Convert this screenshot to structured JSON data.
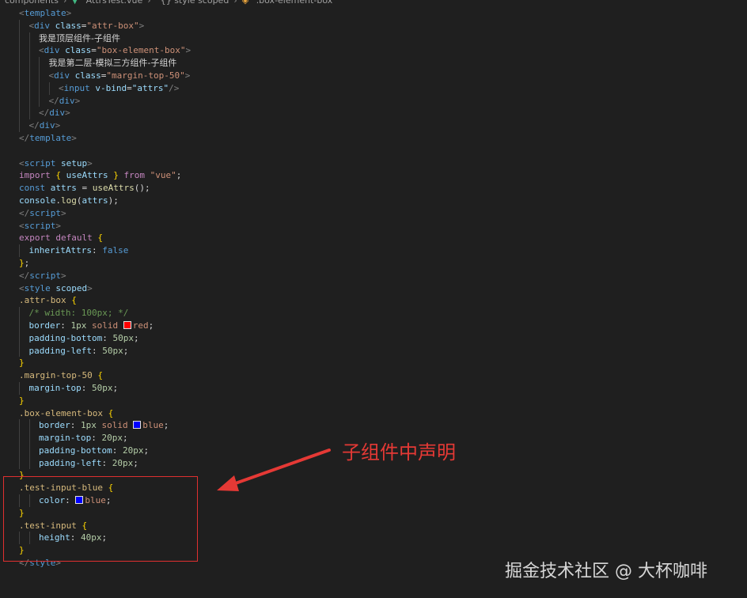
{
  "breadcrumb": [
    "components",
    "AttrsTest.vue",
    "{} style scoped",
    ".box-element-box"
  ],
  "code_lines": [
    {
      "indent": 0,
      "tokens": [
        [
          "ang",
          "<"
        ],
        [
          "tag",
          "template"
        ],
        [
          "ang",
          ">"
        ]
      ]
    },
    {
      "indent": 1,
      "tokens": [
        [
          "ang",
          "<"
        ],
        [
          "tag",
          "div"
        ],
        [
          "punc",
          " "
        ],
        [
          "attr",
          "class"
        ],
        [
          "punc",
          "="
        ],
        [
          "str",
          "\"attr-box\""
        ],
        [
          "ang",
          ">"
        ]
      ]
    },
    {
      "indent": 2,
      "tokens": [
        [
          "txt",
          "我是顶层组件-子组件"
        ]
      ]
    },
    {
      "indent": 2,
      "tokens": [
        [
          "ang",
          "<"
        ],
        [
          "tag",
          "div"
        ],
        [
          "punc",
          " "
        ],
        [
          "attr",
          "class"
        ],
        [
          "punc",
          "="
        ],
        [
          "str",
          "\"box-element-box\""
        ],
        [
          "ang",
          ">"
        ]
      ]
    },
    {
      "indent": 3,
      "tokens": [
        [
          "txt",
          "我是第二层-模拟三方组件-子组件"
        ]
      ]
    },
    {
      "indent": 3,
      "tokens": [
        [
          "ang",
          "<"
        ],
        [
          "tag",
          "div"
        ],
        [
          "punc",
          " "
        ],
        [
          "attr",
          "class"
        ],
        [
          "punc",
          "="
        ],
        [
          "str",
          "\"margin-top-50\""
        ],
        [
          "ang",
          ">"
        ]
      ]
    },
    {
      "indent": 4,
      "tokens": [
        [
          "ang",
          "<"
        ],
        [
          "tag",
          "input"
        ],
        [
          "punc",
          " "
        ],
        [
          "attr",
          "v-bind"
        ],
        [
          "punc",
          "="
        ],
        [
          "var",
          "\"attrs\""
        ],
        [
          "ang",
          "/>"
        ]
      ]
    },
    {
      "indent": 3,
      "tokens": [
        [
          "ang",
          "</"
        ],
        [
          "tag",
          "div"
        ],
        [
          "ang",
          ">"
        ]
      ]
    },
    {
      "indent": 2,
      "tokens": [
        [
          "ang",
          "</"
        ],
        [
          "tag",
          "div"
        ],
        [
          "ang",
          ">"
        ]
      ]
    },
    {
      "indent": 1,
      "tokens": [
        [
          "ang",
          "</"
        ],
        [
          "tag",
          "div"
        ],
        [
          "ang",
          ">"
        ]
      ]
    },
    {
      "indent": 0,
      "tokens": [
        [
          "ang",
          "</"
        ],
        [
          "tag",
          "template"
        ],
        [
          "ang",
          ">"
        ]
      ]
    },
    {
      "indent": 0,
      "tokens": []
    },
    {
      "indent": 0,
      "tokens": [
        [
          "ang",
          "<"
        ],
        [
          "tag",
          "script"
        ],
        [
          "punc",
          " "
        ],
        [
          "attr",
          "setup"
        ],
        [
          "ang",
          ">"
        ]
      ]
    },
    {
      "indent": 0,
      "tokens": [
        [
          "kw",
          "import"
        ],
        [
          "punc",
          " "
        ],
        [
          "brace",
          "{"
        ],
        [
          "punc",
          " "
        ],
        [
          "var",
          "useAttrs"
        ],
        [
          "punc",
          " "
        ],
        [
          "brace",
          "}"
        ],
        [
          "punc",
          " "
        ],
        [
          "kw",
          "from"
        ],
        [
          "punc",
          " "
        ],
        [
          "str",
          "\"vue\""
        ],
        [
          "punc",
          ";"
        ]
      ]
    },
    {
      "indent": 0,
      "tokens": [
        [
          "tag",
          "const"
        ],
        [
          "punc",
          " "
        ],
        [
          "var",
          "attrs"
        ],
        [
          "punc",
          " = "
        ],
        [
          "fn",
          "useAttrs"
        ],
        [
          "punc",
          "();"
        ]
      ]
    },
    {
      "indent": 0,
      "tokens": [
        [
          "var",
          "console"
        ],
        [
          "punc",
          "."
        ],
        [
          "fn",
          "log"
        ],
        [
          "punc",
          "("
        ],
        [
          "var",
          "attrs"
        ],
        [
          "punc",
          ");"
        ]
      ]
    },
    {
      "indent": 0,
      "tokens": [
        [
          "ang",
          "</"
        ],
        [
          "tag",
          "script"
        ],
        [
          "ang",
          ">"
        ]
      ]
    },
    {
      "indent": 0,
      "tokens": [
        [
          "ang",
          "<"
        ],
        [
          "tag",
          "script"
        ],
        [
          "ang",
          ">"
        ]
      ]
    },
    {
      "indent": 0,
      "tokens": [
        [
          "kw",
          "export"
        ],
        [
          "punc",
          " "
        ],
        [
          "kw",
          "default"
        ],
        [
          "punc",
          " "
        ],
        [
          "brace",
          "{"
        ]
      ]
    },
    {
      "indent": 1,
      "tokens": [
        [
          "var",
          "inheritAttrs"
        ],
        [
          "punc",
          ": "
        ],
        [
          "tag",
          "false"
        ]
      ]
    },
    {
      "indent": 0,
      "tokens": [
        [
          "brace",
          "}"
        ],
        [
          "punc",
          ";"
        ]
      ]
    },
    {
      "indent": 0,
      "tokens": [
        [
          "ang",
          "</"
        ],
        [
          "tag",
          "script"
        ],
        [
          "ang",
          ">"
        ]
      ]
    },
    {
      "indent": 0,
      "tokens": [
        [
          "ang",
          "<"
        ],
        [
          "tag",
          "style"
        ],
        [
          "punc",
          " "
        ],
        [
          "attr",
          "scoped"
        ],
        [
          "ang",
          ">"
        ]
      ]
    },
    {
      "indent": 0,
      "tokens": [
        [
          "sel",
          ".attr-box"
        ],
        [
          "punc",
          " "
        ],
        [
          "brace",
          "{"
        ]
      ]
    },
    {
      "indent": 1,
      "tokens": [
        [
          "com",
          "/* width: 100px; */"
        ]
      ]
    },
    {
      "indent": 1,
      "tokens": [
        [
          "prop",
          "border"
        ],
        [
          "punc",
          ": "
        ],
        [
          "num",
          "1px"
        ],
        [
          "punc",
          " "
        ],
        [
          "val",
          "solid"
        ],
        [
          "punc",
          " "
        ],
        [
          "swatch",
          "#ff0000"
        ],
        [
          "val",
          "red"
        ],
        [
          "punc",
          ";"
        ]
      ]
    },
    {
      "indent": 1,
      "tokens": [
        [
          "prop",
          "padding-bottom"
        ],
        [
          "punc",
          ": "
        ],
        [
          "num",
          "50px"
        ],
        [
          "punc",
          ";"
        ]
      ]
    },
    {
      "indent": 1,
      "tokens": [
        [
          "prop",
          "padding-left"
        ],
        [
          "punc",
          ": "
        ],
        [
          "num",
          "50px"
        ],
        [
          "punc",
          ";"
        ]
      ]
    },
    {
      "indent": 0,
      "tokens": [
        [
          "brace",
          "}"
        ]
      ]
    },
    {
      "indent": 0,
      "tokens": [
        [
          "sel",
          ".margin-top-50"
        ],
        [
          "punc",
          " "
        ],
        [
          "brace",
          "{"
        ]
      ]
    },
    {
      "indent": 1,
      "tokens": [
        [
          "prop",
          "margin-top"
        ],
        [
          "punc",
          ": "
        ],
        [
          "num",
          "50px"
        ],
        [
          "punc",
          ";"
        ]
      ]
    },
    {
      "indent": 0,
      "tokens": [
        [
          "brace",
          "}"
        ]
      ]
    },
    {
      "indent": 0,
      "tokens": [
        [
          "sel",
          ".box-element-box"
        ],
        [
          "punc",
          " "
        ],
        [
          "brace",
          "{"
        ]
      ]
    },
    {
      "indent": 2,
      "tokens": [
        [
          "prop",
          "border"
        ],
        [
          "punc",
          ": "
        ],
        [
          "num",
          "1px"
        ],
        [
          "punc",
          " "
        ],
        [
          "val",
          "solid"
        ],
        [
          "punc",
          " "
        ],
        [
          "swatch",
          "#0000ff"
        ],
        [
          "val",
          "blue"
        ],
        [
          "punc",
          ";"
        ]
      ]
    },
    {
      "indent": 2,
      "tokens": [
        [
          "prop",
          "margin-top"
        ],
        [
          "punc",
          ": "
        ],
        [
          "num",
          "20px"
        ],
        [
          "punc",
          ";"
        ]
      ]
    },
    {
      "indent": 2,
      "tokens": [
        [
          "prop",
          "padding-bottom"
        ],
        [
          "punc",
          ": "
        ],
        [
          "num",
          "20px"
        ],
        [
          "punc",
          ";"
        ]
      ]
    },
    {
      "indent": 2,
      "tokens": [
        [
          "prop",
          "padding-left"
        ],
        [
          "punc",
          ": "
        ],
        [
          "num",
          "20px"
        ],
        [
          "punc",
          ";"
        ]
      ]
    },
    {
      "indent": 0,
      "tokens": [
        [
          "brace",
          "}"
        ]
      ]
    },
    {
      "indent": 0,
      "tokens": [
        [
          "sel",
          ".test-input-blue"
        ],
        [
          "punc",
          " "
        ],
        [
          "brace",
          "{"
        ]
      ]
    },
    {
      "indent": 2,
      "tokens": [
        [
          "prop",
          "color"
        ],
        [
          "punc",
          ": "
        ],
        [
          "swatch",
          "#0000ff"
        ],
        [
          "val",
          "blue"
        ],
        [
          "punc",
          ";"
        ]
      ]
    },
    {
      "indent": 0,
      "tokens": [
        [
          "brace",
          "}"
        ]
      ]
    },
    {
      "indent": 0,
      "tokens": [
        [
          "sel",
          ".test-input"
        ],
        [
          "punc",
          " "
        ],
        [
          "brace",
          "{"
        ]
      ]
    },
    {
      "indent": 2,
      "tokens": [
        [
          "prop",
          "height"
        ],
        [
          "punc",
          ": "
        ],
        [
          "num",
          "40px"
        ],
        [
          "punc",
          ";"
        ]
      ]
    },
    {
      "indent": 0,
      "tokens": [
        [
          "brace",
          "}"
        ]
      ]
    },
    {
      "indent": 0,
      "tokens": [
        [
          "ang",
          "</"
        ],
        [
          "tag",
          "style"
        ],
        [
          "ang",
          ">"
        ]
      ]
    }
  ],
  "annotation": {
    "text": "子组件中声明",
    "color": "#e53935"
  },
  "watermark": "掘金技术社区 @ 大杯咖啡",
  "colors": {
    "background": "#1f1f1f",
    "accent": "#e03030"
  }
}
